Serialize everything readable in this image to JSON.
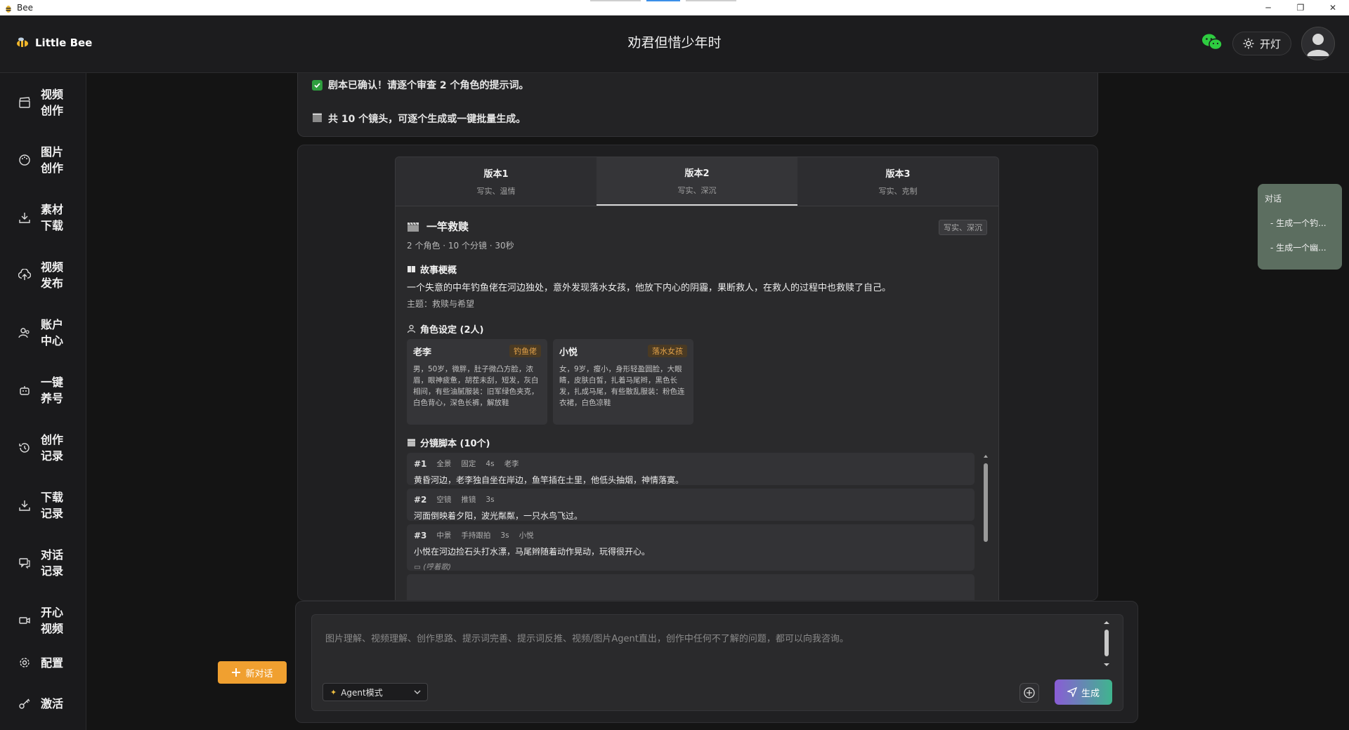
{
  "window": {
    "title": "Bee"
  },
  "header": {
    "brand": "Little Bee",
    "title": "劝君但惜少年时",
    "light_label": "开灯"
  },
  "sidebar": {
    "items": [
      {
        "label": "视频创作",
        "icon": "clapperboard-icon"
      },
      {
        "label": "图片创作",
        "icon": "palette-icon"
      },
      {
        "label": "素材下载",
        "icon": "download-icon"
      },
      {
        "label": "视频发布",
        "icon": "upload-icon"
      },
      {
        "label": "账户中心",
        "icon": "users-icon"
      },
      {
        "label": "一键养号",
        "icon": "robot-icon"
      },
      {
        "label": "创作记录",
        "icon": "history-icon"
      },
      {
        "label": "下载记录",
        "icon": "download-icon"
      },
      {
        "label": "对话记录",
        "icon": "chat-icon"
      },
      {
        "label": "开心视频",
        "icon": "video-icon"
      },
      {
        "label": "配置",
        "icon": "gear-icon"
      },
      {
        "label": "激活",
        "icon": "key-icon"
      }
    ]
  },
  "messages": {
    "confirmed": "剧本已确认！请逐个审查 2 个角色的提示词。",
    "shots_info": "共 10 个镜头，可逐个生成或一键批量生成。"
  },
  "variants": {
    "tabs": [
      {
        "label": "版本1",
        "sub": "写实、温情"
      },
      {
        "label": "版本2",
        "sub": "写实、深沉"
      },
      {
        "label": "版本3",
        "sub": "写实、克制"
      }
    ],
    "active_index": 1,
    "title": "一竿救赎",
    "style_tag": "写实、深沉",
    "meta": "2 个角色 · 10 个分镜 · 30秒",
    "synopsis_heading": "故事梗概",
    "synopsis": "一个失意的中年钓鱼佬在河边独处，意外发现落水女孩，他放下内心的阴霾，果断救人，在救人的过程中也救赎了自己。",
    "theme": "主题：救赎与希望",
    "characters_heading": "角色设定 (2人)",
    "characters": [
      {
        "name": "老李",
        "role": "钓鱼佬",
        "desc": "男，50岁，微胖，肚子微凸方脸，浓眉，眼神疲惫，胡茬未刮，短发，灰白相间，有些油腻服装：旧军绿色夹克，白色背心，深色长裤，解放鞋"
      },
      {
        "name": "小悦",
        "role": "落水女孩",
        "desc": "女，9岁，瘦小，身形轻盈圆脸，大眼睛，皮肤白皙，扎着马尾辫，黑色长发，扎成马尾，有些散乱服装：粉色连衣裙，白色凉鞋"
      }
    ],
    "shots_heading": "分镜脚本 (10个)",
    "shots": [
      {
        "num": "#1",
        "shot": "全景",
        "camera": "固定",
        "duration": "4s",
        "character": "老李",
        "text": "黄昏河边，老李独自坐在岸边，鱼竿插在土里，他低头抽烟，神情落寞。",
        "note": ""
      },
      {
        "num": "#2",
        "shot": "空镜",
        "camera": "推镜",
        "duration": "3s",
        "character": "",
        "text": "河面倒映着夕阳，波光粼粼，一只水鸟飞过。",
        "note": ""
      },
      {
        "num": "#3",
        "shot": "中景",
        "camera": "手持跟拍",
        "duration": "3s",
        "character": "小悦",
        "text": "小悦在河边捡石头打水漂，马尾辫随着动作晃动，玩得很开心。",
        "note": "(哼着歌)"
      }
    ]
  },
  "chat_float": {
    "title": "对话",
    "items": [
      "- 生成一个钓...",
      "- 生成一个幽..."
    ]
  },
  "new_chat": {
    "label": "新对话"
  },
  "composer": {
    "placeholder": "图片理解、视频理解、创作思路、提示词完善、提示词反推、视频/图片Agent直出，创作中任何不了解的问题，都可以向我咨询。",
    "mode": "Agent模式",
    "generate": "生成"
  },
  "colors": {
    "accent_orange": "#f0a030",
    "success_green": "#2e9e3e",
    "wechat_green": "#2ecc40"
  }
}
